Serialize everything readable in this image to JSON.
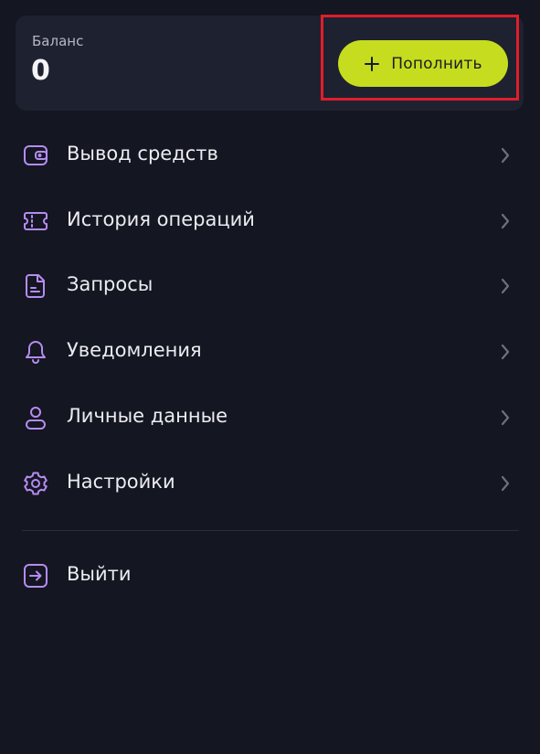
{
  "balance": {
    "label": "Баланс",
    "value": "0",
    "topup_label": "Пополнить"
  },
  "menu": [
    {
      "label": "Вывод средств",
      "icon": "wallet-icon"
    },
    {
      "label": "История операций",
      "icon": "ticket-icon"
    },
    {
      "label": "Запросы",
      "icon": "document-icon"
    },
    {
      "label": "Уведомления",
      "icon": "bell-icon"
    },
    {
      "label": "Личные данные",
      "icon": "user-icon"
    },
    {
      "label": "Настройки",
      "icon": "gear-icon"
    }
  ],
  "logout": {
    "label": "Выйти",
    "icon": "logout-icon"
  },
  "colors": {
    "background": "#141621",
    "card": "#1e2130",
    "accent": "#c6dd1f",
    "icon": "#b58cf2",
    "highlight": "#e11d2a"
  }
}
